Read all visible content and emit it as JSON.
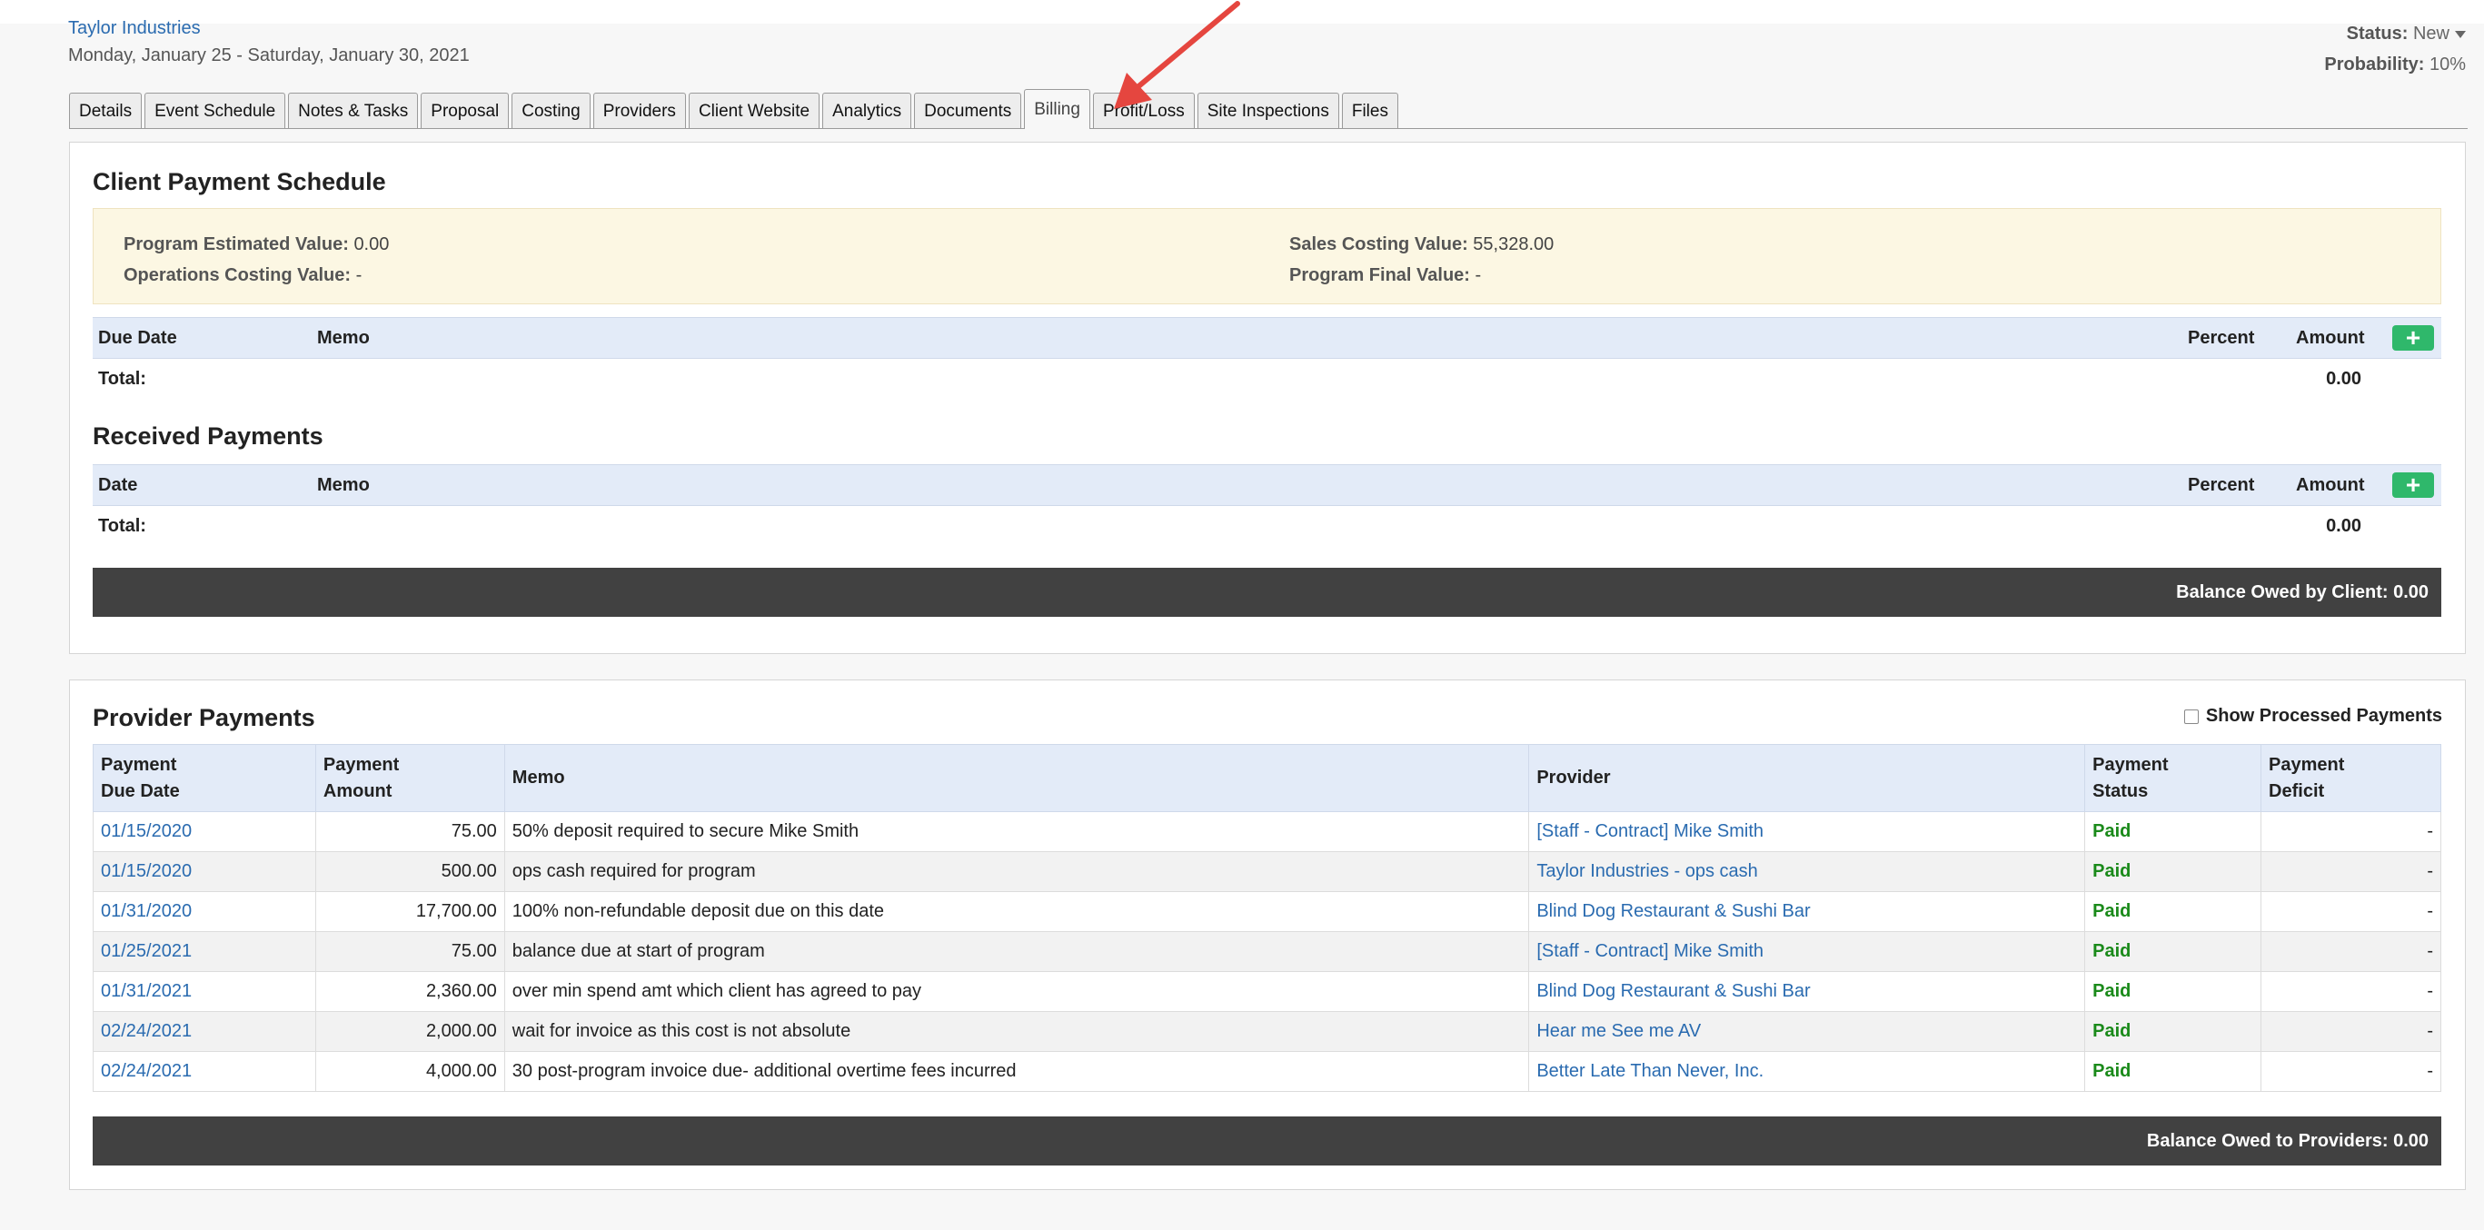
{
  "header": {
    "client_name": "Taylor Industries",
    "date_range": "Monday, January 25 - Saturday, January 30, 2021",
    "status_label": "Status:",
    "status_value": "New",
    "probability_label": "Probability:",
    "probability_value": "10%"
  },
  "tabs": [
    {
      "label": "Details"
    },
    {
      "label": "Event Schedule"
    },
    {
      "label": "Notes & Tasks"
    },
    {
      "label": "Proposal"
    },
    {
      "label": "Costing"
    },
    {
      "label": "Providers"
    },
    {
      "label": "Client Website"
    },
    {
      "label": "Analytics"
    },
    {
      "label": "Documents"
    },
    {
      "label": "Billing"
    },
    {
      "label": "Profit/Loss"
    },
    {
      "label": "Site Inspections"
    },
    {
      "label": "Files"
    }
  ],
  "client_payment_schedule": {
    "title": "Client Payment Schedule",
    "program_estimated_label": "Program Estimated Value:",
    "program_estimated_value": "0.00",
    "operations_costing_label": "Operations Costing Value:",
    "operations_costing_value": "-",
    "sales_costing_label": "Sales Costing Value:",
    "sales_costing_value": "55,328.00",
    "program_final_label": "Program Final Value:",
    "program_final_value": "-",
    "columns": {
      "due_date": "Due Date",
      "memo": "Memo",
      "percent": "Percent",
      "amount": "Amount"
    },
    "add_symbol": "+",
    "total_label": "Total:",
    "total_value": "0.00"
  },
  "received_payments": {
    "title": "Received Payments",
    "columns": {
      "date": "Date",
      "memo": "Memo",
      "percent": "Percent",
      "amount": "Amount"
    },
    "add_symbol": "+",
    "total_label": "Total:",
    "total_value": "0.00",
    "balance_text": "Balance Owed by Client: 0.00"
  },
  "provider_payments": {
    "title": "Provider Payments",
    "show_processed_label": "Show Processed Payments",
    "columns": {
      "due_date_1": "Payment",
      "due_date_2": "Due Date",
      "amount_1": "Payment",
      "amount_2": "Amount",
      "memo": "Memo",
      "provider": "Provider",
      "status_1": "Payment",
      "status_2": "Status",
      "deficit_1": "Payment",
      "deficit_2": "Deficit"
    },
    "rows": [
      {
        "due_date": "01/15/2020",
        "amount": "75.00",
        "memo": "50% deposit required to secure Mike Smith",
        "provider": "[Staff - Contract] Mike Smith",
        "status": "Paid",
        "deficit": "-"
      },
      {
        "due_date": "01/15/2020",
        "amount": "500.00",
        "memo": "ops cash required for program",
        "provider": "Taylor Industries - ops cash",
        "status": "Paid",
        "deficit": "-"
      },
      {
        "due_date": "01/31/2020",
        "amount": "17,700.00",
        "memo": "100% non-refundable deposit due on this date",
        "provider": "Blind Dog Restaurant & Sushi Bar",
        "status": "Paid",
        "deficit": "-"
      },
      {
        "due_date": "01/25/2021",
        "amount": "75.00",
        "memo": "balance due at start of program",
        "provider": "[Staff - Contract] Mike Smith",
        "status": "Paid",
        "deficit": "-"
      },
      {
        "due_date": "01/31/2021",
        "amount": "2,360.00",
        "memo": "over min spend amt which client has agreed to pay",
        "provider": "Blind Dog Restaurant & Sushi Bar",
        "status": "Paid",
        "deficit": "-"
      },
      {
        "due_date": "02/24/2021",
        "amount": "2,000.00",
        "memo": "wait for invoice as this cost is not absolute",
        "provider": "Hear me See me AV",
        "status": "Paid",
        "deficit": "-"
      },
      {
        "due_date": "02/24/2021",
        "amount": "4,000.00",
        "memo": "30 post-program invoice due- additional overtime fees incurred",
        "provider": "Better Late Than Never, Inc.",
        "status": "Paid",
        "deficit": "-"
      }
    ],
    "balance_text": "Balance Owed to Providers: 0.00"
  },
  "colors": {
    "accent_link": "#2a6bb0",
    "paid_green": "#1a8a1a",
    "add_button_green": "#2fb86b",
    "balance_bar": "#414141",
    "table_header": "#e3ebf8",
    "info_box": "#fcf7e3",
    "arrow_red": "#e5463f"
  }
}
